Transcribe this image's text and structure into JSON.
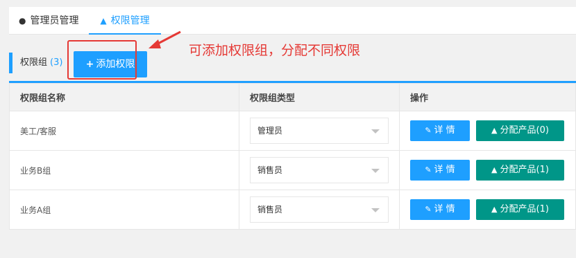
{
  "tabs": [
    {
      "label": "管理员管理",
      "icon": "user-icon"
    },
    {
      "label": "权限管理",
      "icon": "sitemap-icon"
    }
  ],
  "toolbar": {
    "title": "权限组",
    "count": "(3)",
    "add_label": "添加权限"
  },
  "annotation": {
    "text": "可添加权限组，分配不同权限",
    "color": "#e53935"
  },
  "table": {
    "headers": [
      "权限组名称",
      "权限组类型",
      "操作"
    ],
    "rows": [
      {
        "name": "美工/客服",
        "type": "管理员",
        "detail_label": "详 情",
        "assign_label": "分配产品(0)"
      },
      {
        "name": "业务B组",
        "type": "销售员",
        "detail_label": "详 情",
        "assign_label": "分配产品(1)"
      },
      {
        "name": "业务A组",
        "type": "销售员",
        "detail_label": "详 情",
        "assign_label": "分配产品(1)"
      }
    ]
  },
  "colors": {
    "primary": "#1e9fff",
    "teal": "#009688"
  }
}
